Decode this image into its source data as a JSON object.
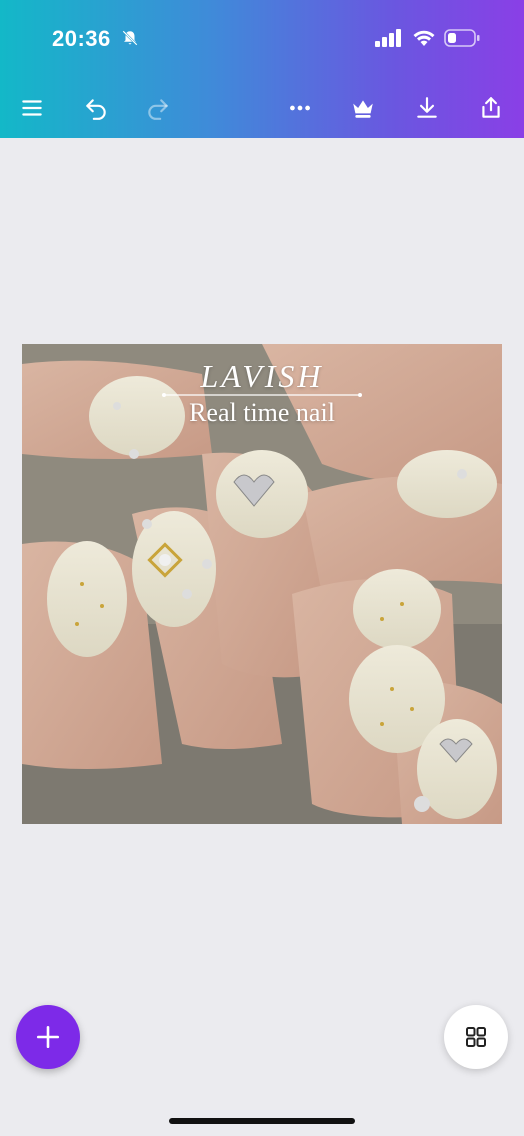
{
  "status_bar": {
    "time": "20:36",
    "icons": [
      "bell-slash-icon",
      "signal-icon",
      "wifi-icon",
      "battery-icon"
    ],
    "battery_level": 0.3
  },
  "toolbar": {
    "left": [
      "menu-icon",
      "undo-icon",
      "redo-icon"
    ],
    "right": [
      "more-icon",
      "crown-icon",
      "download-icon",
      "share-icon"
    ]
  },
  "design": {
    "title": "LAVISH",
    "subtitle": "Real time nail"
  },
  "fab": {
    "add_icon": "plus-icon",
    "grid_icon": "grid-icon"
  },
  "colors": {
    "accent": "#7d2ae8",
    "gradient_start": "#13b8c8",
    "gradient_end": "#8a3fe6",
    "background": "#ebebef"
  }
}
